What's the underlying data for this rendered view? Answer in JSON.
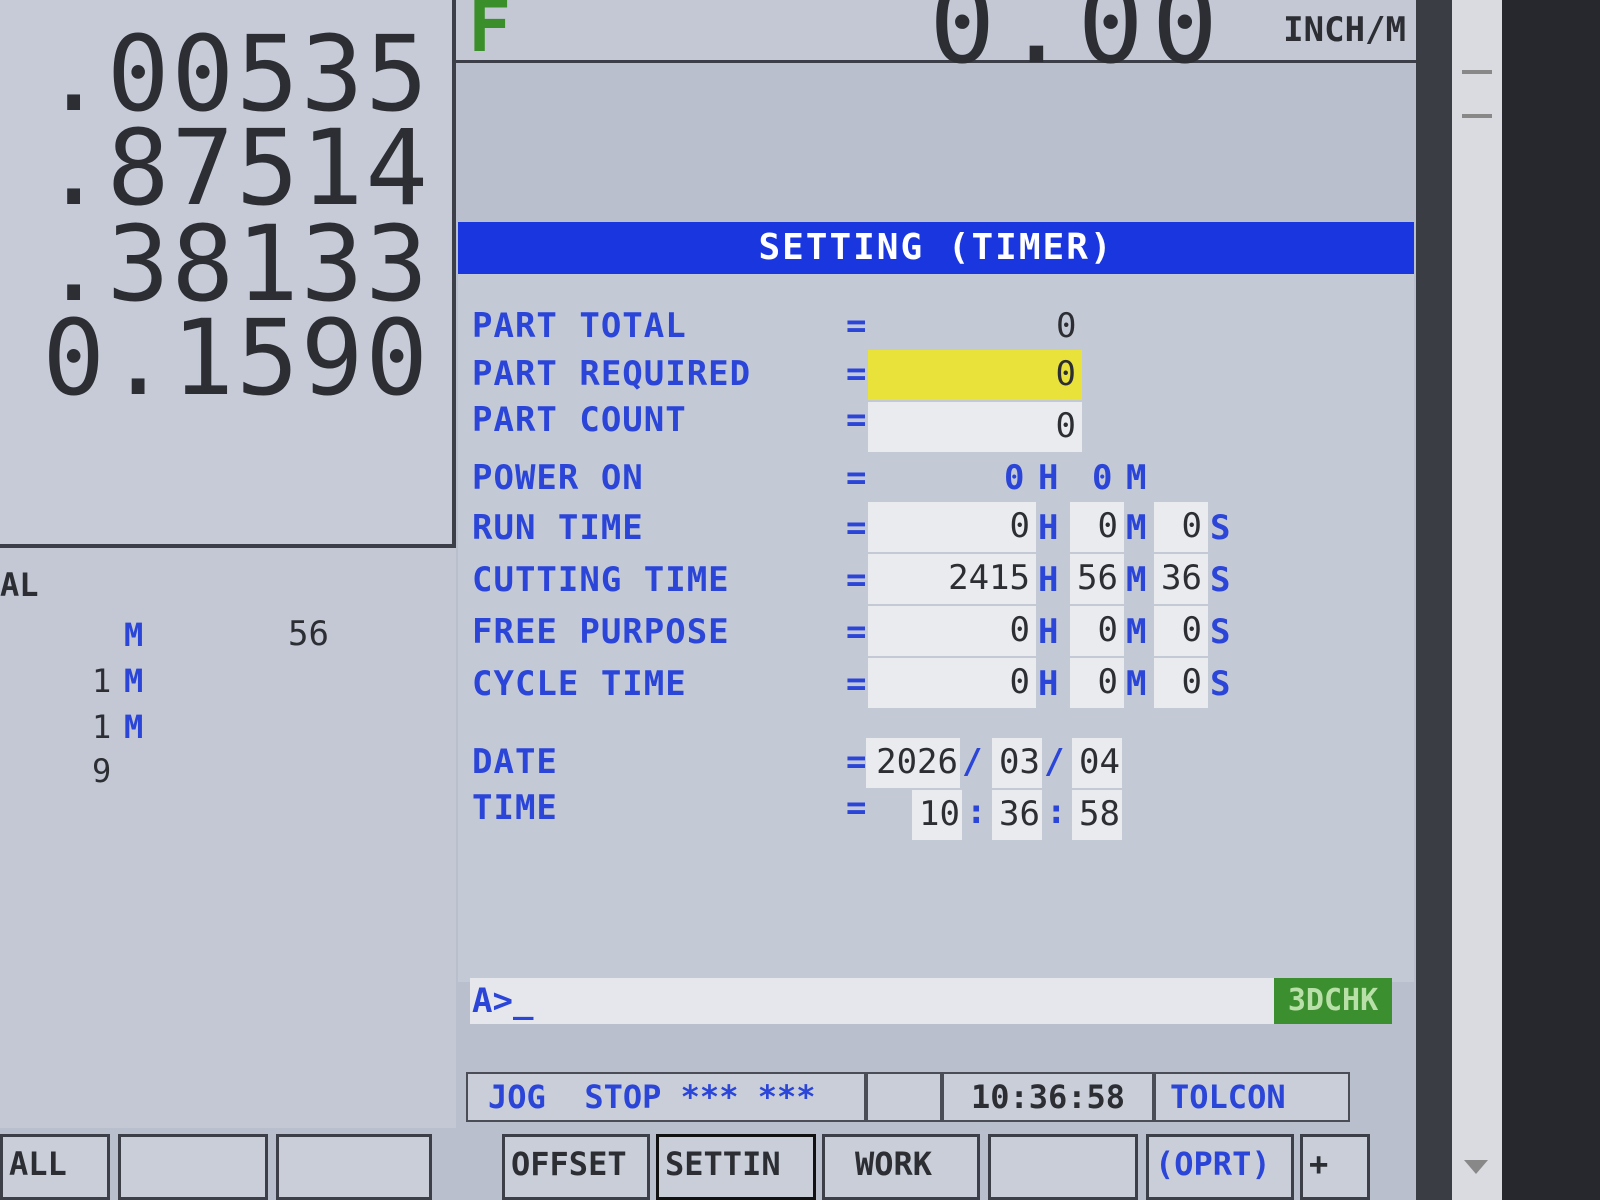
{
  "positions": [
    ".00535",
    ".87514",
    ".38133",
    "0.1590"
  ],
  "left_lower": {
    "header": "AL",
    "rows": [
      {
        "a": "",
        "unit": "M",
        "b": "56"
      },
      {
        "a": "1",
        "unit": "M",
        "b": ""
      },
      {
        "a": "1",
        "unit": "M",
        "b": ""
      },
      {
        "a": "9",
        "unit": "",
        "b": ""
      }
    ]
  },
  "feed": {
    "letter": "F",
    "value": "0.00",
    "unit": "INCH/M"
  },
  "timer": {
    "title": "SETTING (TIMER)",
    "eq": "=",
    "part_total": {
      "label": "PART TOTAL",
      "value": "0"
    },
    "part_required": {
      "label": "PART REQUIRED",
      "value": "0"
    },
    "part_count": {
      "label": "PART COUNT",
      "value": "0"
    },
    "power_on": {
      "label": "POWER ON",
      "h": "0",
      "m": "0"
    },
    "run_time": {
      "label": "RUN TIME",
      "h": "0",
      "m": "0",
      "s": "0"
    },
    "cutting_time": {
      "label": "CUTTING TIME",
      "h": "2415",
      "m": "56",
      "s": "36"
    },
    "free_purpose": {
      "label": "FREE PURPOSE",
      "h": "0",
      "m": "0",
      "s": "0"
    },
    "cycle_time": {
      "label": "CYCLE TIME",
      "h": "0",
      "m": "0",
      "s": "0"
    },
    "date": {
      "label": "DATE",
      "year": "2026",
      "month": "03",
      "day": "04",
      "sep": "/"
    },
    "time": {
      "label": "TIME",
      "hh": "10",
      "mm": "36",
      "ss": "58",
      "sep": ":"
    },
    "units": {
      "h": "H",
      "m": "M",
      "s": "S"
    }
  },
  "command": {
    "prompt": "A>_",
    "badge": "3DCHK"
  },
  "status": {
    "mode": "JOG  STOP *** ***",
    "blank": "",
    "clock": "10:36:58",
    "tolcon": "TOLCON"
  },
  "softkeys": {
    "left": [
      "ALL",
      "",
      ""
    ],
    "right": [
      "OFFSET",
      "SETTIN",
      "WORK",
      "",
      "(OPRT)",
      "+"
    ]
  },
  "colors": {
    "accent_blue": "#1a37df",
    "label_blue": "#2b45d8",
    "highlight_yellow": "#e8e23a",
    "badge_green": "#3c8f2e"
  }
}
